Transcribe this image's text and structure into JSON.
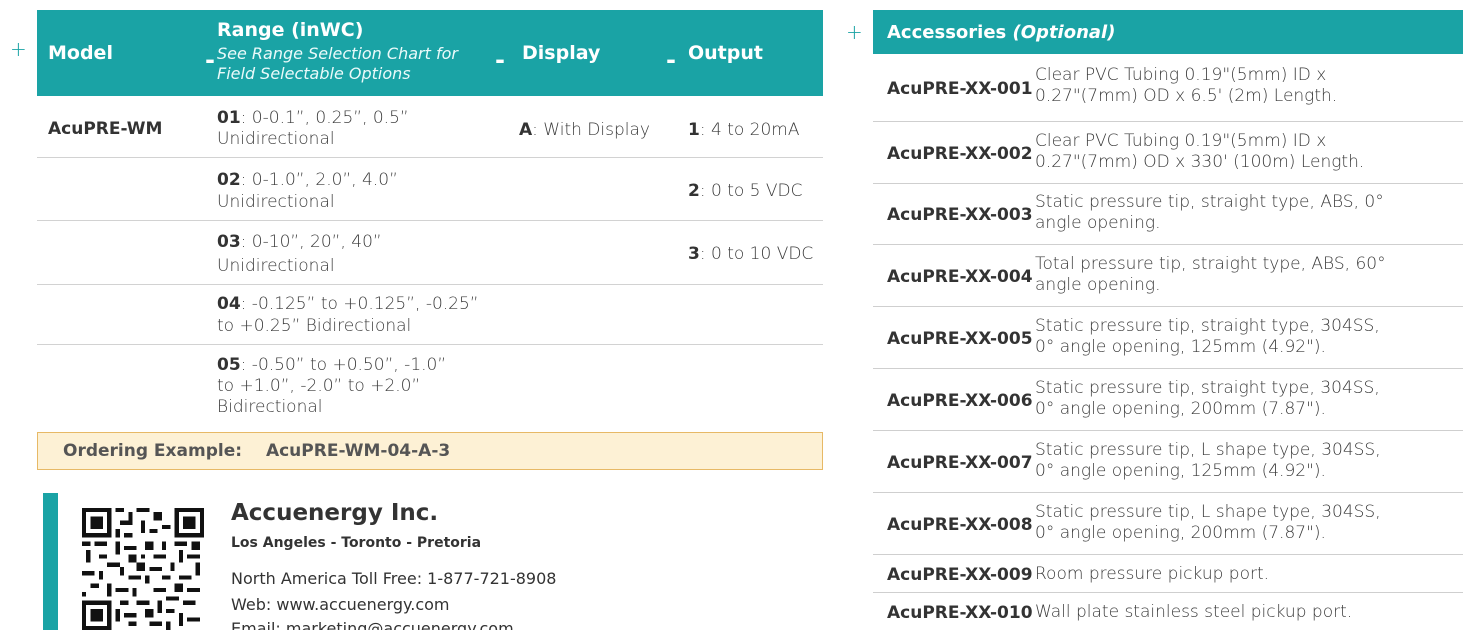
{
  "ordering": {
    "headers": {
      "model": "Model",
      "range_title": "Range (inWC)",
      "range_sub": "See Range Selection Chart for Field Selectable Options",
      "display": "Display",
      "output": "Output",
      "separator": "-"
    },
    "plus": "+",
    "model": "AcuPRE-WM",
    "ranges": [
      {
        "code": "01",
        "text": ": 0-0.1”, 0.25”, 0.5”",
        "text2": "Unidirectional"
      },
      {
        "code": "02",
        "text": ": 0-1.0”, 2.0”, 4.0”",
        "text2": "Unidirectional"
      },
      {
        "code": "03",
        "text": ": 0-10”, 20”, 40”",
        "text2": "Unidirectional"
      },
      {
        "code": "04",
        "text": ": -0.125” to +0.125”, -0.25”",
        "text2": "to +0.25” Bidirectional"
      },
      {
        "code": "05",
        "text": ": -0.50” to +0.50”, -1.0”",
        "text2": "to +1.0”, -2.0” to +2.0”",
        "text3": "Bidirectional"
      }
    ],
    "display": {
      "code": "A",
      "text": ": With Display"
    },
    "outputs": [
      {
        "code": "1",
        "text": ": 4 to 20mA"
      },
      {
        "code": "2",
        "text": ": 0 to 5 VDC"
      },
      {
        "code": "3",
        "text": ": 0 to 10 VDC"
      }
    ],
    "example_label": "Ordering Example:",
    "example_code": "AcuPRE-WM-04-A-3"
  },
  "company": {
    "name": "Accuenergy Inc.",
    "cities": "Los Angeles - Toronto - Pretoria",
    "toll_free": "North America Toll Free: 1-877-721-8908",
    "web": "Web: www.accuenergy.com",
    "email": "Email: marketing@accuenergy.com"
  },
  "accessories": {
    "plus": "+",
    "title": "Accessories",
    "title_note": "(Optional)",
    "items": [
      {
        "code": "AcuPRE-XX-001",
        "desc": "Clear PVC Tubing 0.19\"(5mm) ID x",
        "desc2": "0.27\"(7mm) OD x 6.5' (2m) Length."
      },
      {
        "code": "AcuPRE-XX-002",
        "desc": "Clear PVC Tubing 0.19\"(5mm) ID x",
        "desc2": "0.27\"(7mm) OD x 330' (100m) Length."
      },
      {
        "code": "AcuPRE-XX-003",
        "desc": "Static pressure tip, straight type, ABS, 0°",
        "desc2": "angle opening."
      },
      {
        "code": "AcuPRE-XX-004",
        "desc": "Total pressure tip, straight type, ABS, 60°",
        "desc2": "angle opening."
      },
      {
        "code": "AcuPRE-XX-005",
        "desc": "Static pressure tip, straight type, 304SS,",
        "desc2": "0° angle opening, 125mm (4.92\")."
      },
      {
        "code": "AcuPRE-XX-006",
        "desc": "Static pressure tip, straight type, 304SS,",
        "desc2": "0° angle opening, 200mm (7.87\")."
      },
      {
        "code": "AcuPRE-XX-007",
        "desc": "Static pressure tip, L shape type, 304SS,",
        "desc2": "0° angle opening, 125mm (4.92\")."
      },
      {
        "code": "AcuPRE-XX-008",
        "desc": "Static pressure tip, L shape type, 304SS,",
        "desc2": "0° angle opening, 200mm (7.87\")."
      },
      {
        "code": "AcuPRE-XX-009",
        "desc": "Room pressure pickup port.",
        "desc2": ""
      },
      {
        "code": "AcuPRE-XX-010",
        "desc": "Wall plate stainless steel pickup port.",
        "desc2": ""
      }
    ]
  }
}
